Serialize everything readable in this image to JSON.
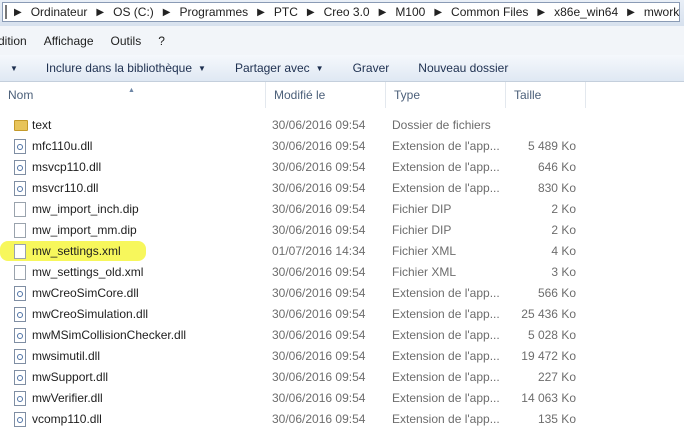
{
  "breadcrumb": {
    "items": [
      "Ordinateur",
      "OS (C:)",
      "Programmes",
      "PTC",
      "Creo 3.0",
      "M100",
      "Common Files",
      "x86e_win64",
      "mworks"
    ]
  },
  "menu": {
    "items": [
      "dition",
      "Affichage",
      "Outils",
      "?"
    ]
  },
  "toolbar": {
    "include_label": "Inclure dans la bibliothèque",
    "share_label": "Partager avec",
    "burn_label": "Graver",
    "new_folder_label": "Nouveau dossier"
  },
  "columns": {
    "name": "Nom",
    "modified": "Modifié le",
    "type": "Type",
    "size": "Taille"
  },
  "files": [
    {
      "name": "text",
      "date": "30/06/2016 09:54",
      "type": "Dossier de fichiers",
      "size": "",
      "icon": "folder-icon"
    },
    {
      "name": "mfc110u.dll",
      "date": "30/06/2016 09:54",
      "type": "Extension de l'app...",
      "size": "5 489 Ko",
      "icon": "dll-icon"
    },
    {
      "name": "msvcp110.dll",
      "date": "30/06/2016 09:54",
      "type": "Extension de l'app...",
      "size": "646 Ko",
      "icon": "dll-icon"
    },
    {
      "name": "msvcr110.dll",
      "date": "30/06/2016 09:54",
      "type": "Extension de l'app...",
      "size": "830 Ko",
      "icon": "dll-icon"
    },
    {
      "name": "mw_import_inch.dip",
      "date": "30/06/2016 09:54",
      "type": "Fichier DIP",
      "size": "2 Ko",
      "icon": "file-icon"
    },
    {
      "name": "mw_import_mm.dip",
      "date": "30/06/2016 09:54",
      "type": "Fichier DIP",
      "size": "2 Ko",
      "icon": "file-icon"
    },
    {
      "name": "mw_settings.xml",
      "date": "01/07/2016 14:34",
      "type": "Fichier XML",
      "size": "4 Ko",
      "icon": "xml-icon"
    },
    {
      "name": "mw_settings_old.xml",
      "date": "30/06/2016 09:54",
      "type": "Fichier XML",
      "size": "3 Ko",
      "icon": "xml-icon"
    },
    {
      "name": "mwCreoSimCore.dll",
      "date": "30/06/2016 09:54",
      "type": "Extension de l'app...",
      "size": "566 Ko",
      "icon": "dll-icon"
    },
    {
      "name": "mwCreoSimulation.dll",
      "date": "30/06/2016 09:54",
      "type": "Extension de l'app...",
      "size": "25 436 Ko",
      "icon": "dll-icon"
    },
    {
      "name": "mwMSimCollisionChecker.dll",
      "date": "30/06/2016 09:54",
      "type": "Extension de l'app...",
      "size": "5 028 Ko",
      "icon": "dll-icon"
    },
    {
      "name": "mwsimutil.dll",
      "date": "30/06/2016 09:54",
      "type": "Extension de l'app...",
      "size": "19 472 Ko",
      "icon": "dll-icon"
    },
    {
      "name": "mwSupport.dll",
      "date": "30/06/2016 09:54",
      "type": "Extension de l'app...",
      "size": "227 Ko",
      "icon": "dll-icon"
    },
    {
      "name": "mwVerifier.dll",
      "date": "30/06/2016 09:54",
      "type": "Extension de l'app...",
      "size": "14 063 Ko",
      "icon": "dll-icon"
    },
    {
      "name": "vcomp110.dll",
      "date": "30/06/2016 09:54",
      "type": "Extension de l'app...",
      "size": "135 Ko",
      "icon": "dll-icon"
    }
  ],
  "colors": {
    "highlight": "#f6f64a",
    "toolbar_text": "#1e3050",
    "header_text": "#4c607a"
  }
}
